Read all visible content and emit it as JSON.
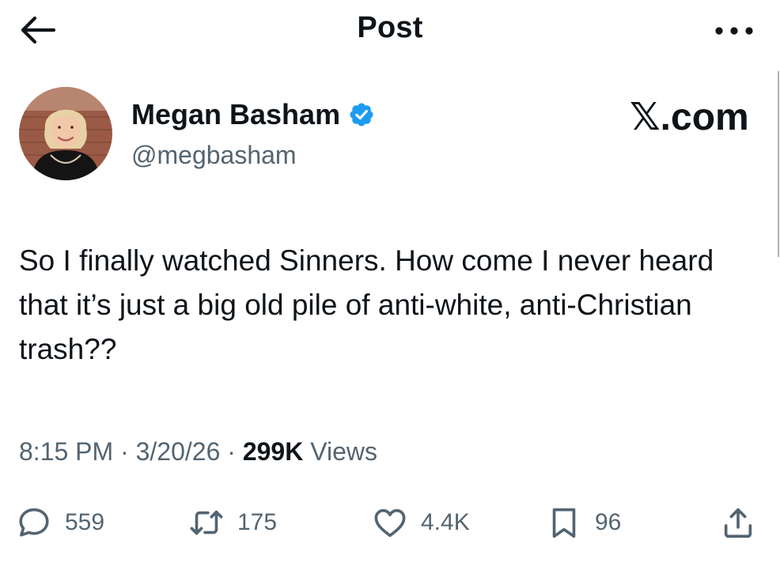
{
  "header": {
    "title": "Post",
    "back_icon": "arrow-left-icon",
    "more_icon": "more-horizontal-icon"
  },
  "author": {
    "name": "Megan Basham",
    "handle": "@megbasham",
    "verified_icon": "verified-badge-icon",
    "verified_color": "#1d9bf0"
  },
  "brand": "𝕏.com",
  "tweet": {
    "text": "So I finally watched Sinners. How come I never heard that it’s just a big old pile of anti-white, anti-Christian trash??",
    "time": "8:15 PM",
    "date": "3/20/26",
    "views_count": "299K",
    "views_label": "Views"
  },
  "actions": {
    "reply": {
      "icon": "reply-icon",
      "count": "559"
    },
    "repost": {
      "icon": "repost-icon",
      "count": "175"
    },
    "like": {
      "icon": "heart-icon",
      "count": "4.4K"
    },
    "bookmark": {
      "icon": "bookmark-icon",
      "count": "96"
    },
    "share": {
      "icon": "share-icon"
    }
  },
  "colors": {
    "text": "#0f1419",
    "secondary": "#536471",
    "background": "#ffffff"
  }
}
